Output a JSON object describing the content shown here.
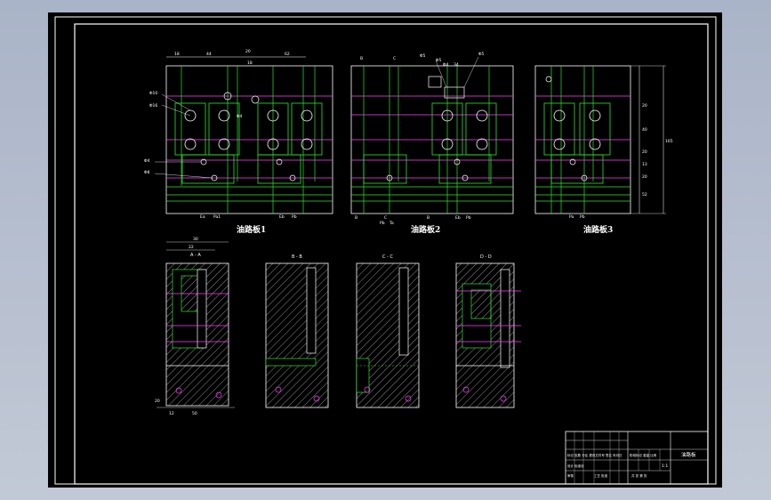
{
  "drawing": {
    "view_labels": {
      "plate1": "油路板1",
      "plate2": "油路板2",
      "plate3": "油路板3"
    },
    "section_labels": {
      "a": "A - A",
      "b": "B - B",
      "c": "C - C",
      "d": "D - D"
    },
    "dimensions": {
      "p1_top": [
        "18",
        "44",
        "20",
        "62"
      ],
      "p1_left": [
        "Φ10",
        "Φ16",
        "Φ4",
        "Φ8"
      ],
      "p1_right": [
        "Φ4",
        "18"
      ],
      "p1_bottom": [
        "Ea",
        "Pa1",
        "Eb",
        "Pb"
      ],
      "p2_top": [
        "B",
        "C",
        "Φ5",
        "Φ5",
        "Φ4",
        "34",
        "Φ5"
      ],
      "p2_bottom": [
        "B",
        "C",
        "Pb",
        "Ta",
        "B",
        "Eb",
        "Pb"
      ],
      "p3_right": [
        "20",
        "40",
        "20",
        "13",
        "20",
        "52"
      ],
      "p3_total": "165",
      "p3_bottom": [
        "Pa",
        "Pb"
      ],
      "sec_a_top": [
        "30",
        "22"
      ],
      "sec_a_bottom": [
        "12",
        "50"
      ],
      "sec_a_side": "20"
    }
  },
  "title_block": {
    "drawing_name": "油路板",
    "scale": "1:1",
    "rows": [
      "标记 处数 分区 更改文件号 签名 年月日",
      "设计 标准化",
      "审核",
      "工艺 批准"
    ],
    "right_cells": [
      "阶段标记 重量 比例",
      "共 张 第 张"
    ]
  }
}
